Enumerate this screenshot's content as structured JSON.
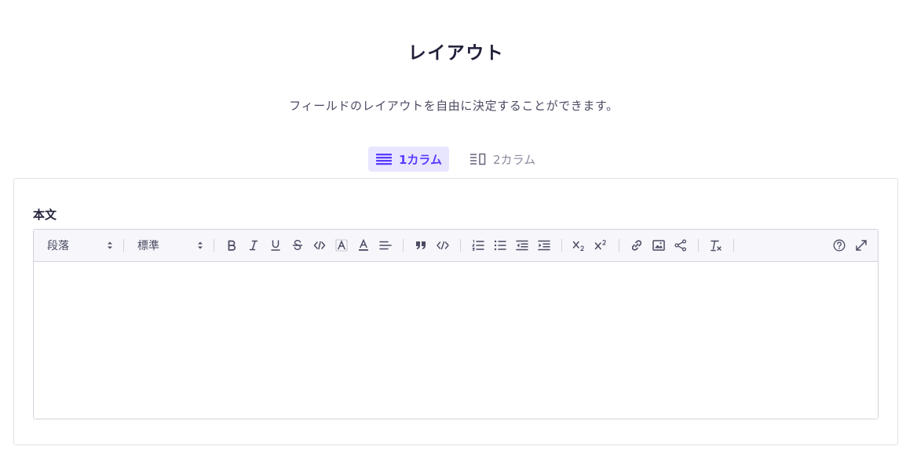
{
  "header": {
    "title": "レイアウト",
    "subtitle": "フィールドのレイアウトを自由に決定することができます。"
  },
  "tabs": [
    {
      "label": "1カラム",
      "icon": "list-rows-icon",
      "active": true
    },
    {
      "label": "2カラム",
      "icon": "two-column-icon",
      "active": false
    }
  ],
  "field": {
    "label": "本文"
  },
  "toolbar": {
    "paragraph_select": "段落",
    "font_size_select": "標準"
  },
  "colors": {
    "accent": "#563bff",
    "accent_bg": "#e8e6ff",
    "toolbar_bg": "#f6f6fb",
    "border": "#d2d2de"
  }
}
